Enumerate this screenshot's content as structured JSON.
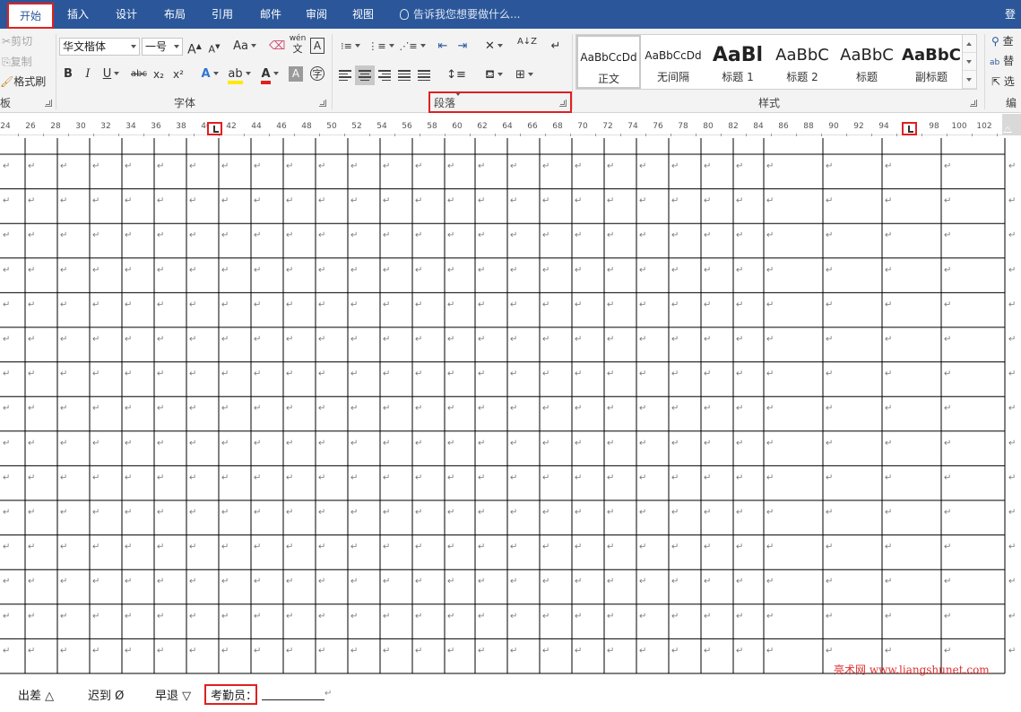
{
  "tabs": [
    {
      "label": "开始",
      "active": true
    },
    {
      "label": "插入"
    },
    {
      "label": "设计"
    },
    {
      "label": "布局"
    },
    {
      "label": "引用"
    },
    {
      "label": "邮件"
    },
    {
      "label": "审阅"
    },
    {
      "label": "视图"
    }
  ],
  "tell_me": "告诉我您想要做什么...",
  "login": "登录",
  "clipboard": {
    "cut": "剪切",
    "copy": "复制",
    "format_painter": "格式刷",
    "label": "板"
  },
  "font": {
    "name": "华文楷体",
    "size": "一号",
    "grow": "A",
    "shrink": "A",
    "case": "Aa",
    "phonetic_top": "wén",
    "phonetic_char": "文",
    "border_char": "A",
    "bold": "B",
    "italic": "I",
    "underline": "U",
    "strike": "abc",
    "subscript": "x₂",
    "superscript": "x²",
    "effects": "A",
    "color": "A",
    "shading": "A",
    "enclose": "字",
    "label": "字体"
  },
  "paragraph": {
    "label": "段落",
    "sort": "A↓Z"
  },
  "styles": {
    "label": "样式",
    "items": [
      {
        "preview": "AaBbCcDd",
        "name": "正文",
        "selected": true
      },
      {
        "preview": "AaBbCcDd",
        "name": "无间隔"
      },
      {
        "preview": "AaBl",
        "name": "标题 1"
      },
      {
        "preview": "AaBbC",
        "name": "标题 2"
      },
      {
        "preview": "AaBbC",
        "name": "标题"
      },
      {
        "preview": "AaBbC",
        "name": "副标题"
      }
    ]
  },
  "editing": {
    "find": "查",
    "replace": "替",
    "select": "选",
    "label": "编"
  },
  "ruler": {
    "numbers": [
      "24",
      "26",
      "28",
      "30",
      "32",
      "34",
      "36",
      "38",
      "40",
      "42",
      "44",
      "46",
      "48",
      "50",
      "52",
      "54",
      "56",
      "58",
      "60",
      "62",
      "64",
      "66",
      "68",
      "70",
      "72",
      "74",
      "76",
      "78",
      "80",
      "82",
      "84",
      "86",
      "88",
      "90",
      "92",
      "94",
      "96",
      "98",
      "100",
      "102"
    ]
  },
  "table": {
    "rows": 15,
    "cell_mark": "↵"
  },
  "footer": {
    "business_trip": "出差",
    "business_trip_symbol": "△",
    "late": "迟到",
    "late_symbol": "Ø",
    "leave_early": "早退",
    "leave_early_symbol": "▽",
    "attendant": "考勤员：",
    "para_mark": "↵"
  },
  "watermark": "亮术网 www.liangshunet.com"
}
